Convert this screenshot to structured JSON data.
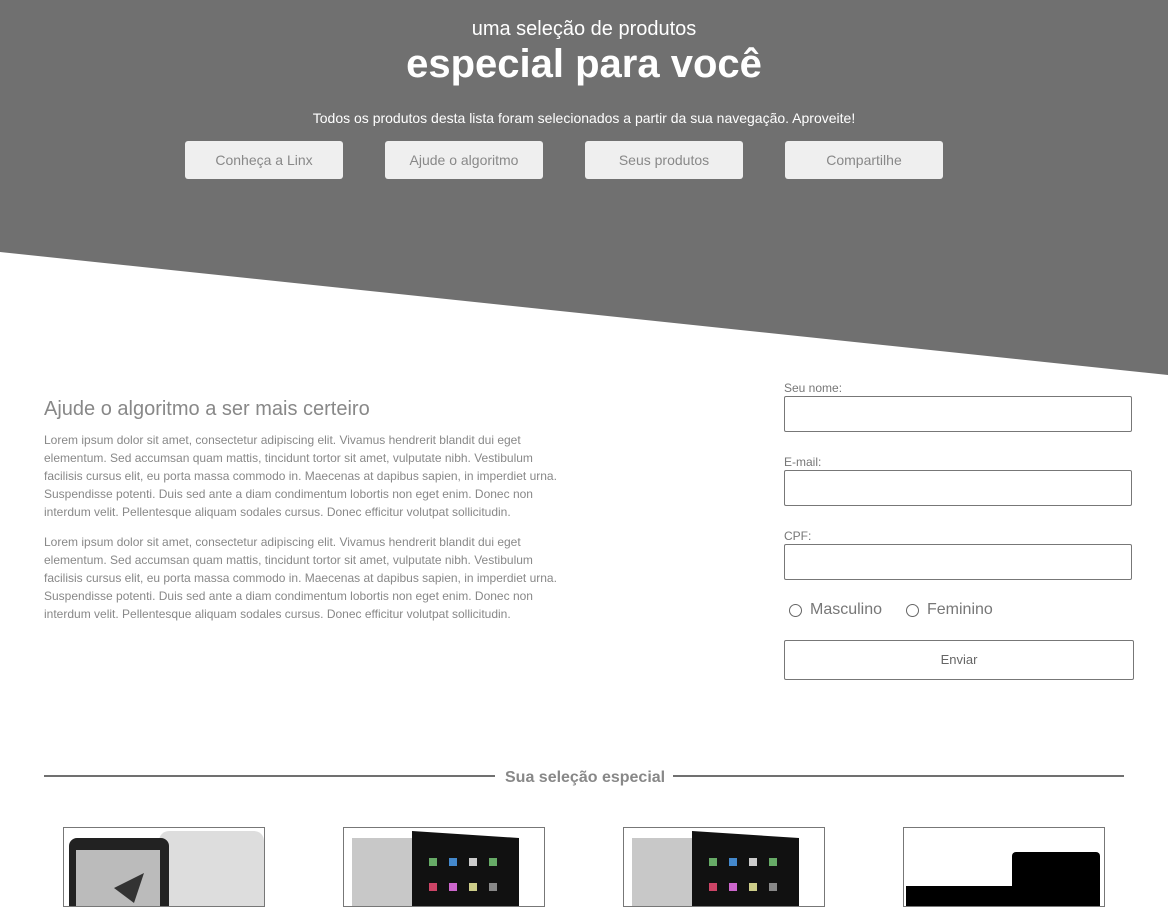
{
  "hero": {
    "subtitle": "uma seleção de produtos",
    "title": "especial para você",
    "description": "Todos os produtos desta lista foram selecionados a partir da sua navegação. Aproveite!",
    "buttons": [
      "Conheça a Linx",
      "Ajude o algoritmo",
      "Seus produtos",
      "Compartilhe"
    ],
    "bg_color": "#707070"
  },
  "info": {
    "heading": "Ajude o algoritmo a ser mais certeiro",
    "paragraphs": [
      "Lorem ipsum dolor sit amet, consectetur adipiscing elit. Vivamus hendrerit blandit dui eget elementum. Sed accumsan quam mattis, tincidunt tortor sit amet, vulputate nibh. Vestibulum facilisis cursus elit, eu porta massa commodo in. Maecenas at dapibus sapien, in imperdiet urna. Suspendisse potenti. Duis sed ante a diam condimentum lobortis non eget enim. Donec non interdum velit. Pellentesque aliquam sodales cursus. Donec efficitur volutpat sollicitudin.",
      "Lorem ipsum dolor sit amet, consectetur adipiscing elit. Vivamus hendrerit blandit dui eget elementum. Sed accumsan quam mattis, tincidunt tortor sit amet, vulputate nibh. Vestibulum facilisis cursus elit, eu porta massa commodo in. Maecenas at dapibus sapien, in imperdiet urna. Suspendisse potenti. Duis sed ante a diam condimentum lobortis non eget enim. Donec non interdum velit. Pellentesque aliquam sodales cursus. Donec efficitur volutpat sollicitudin."
    ]
  },
  "form": {
    "name_label": "Seu nome:",
    "email_label": "E-mail:",
    "cpf_label": "CPF:",
    "name_value": "",
    "email_value": "",
    "cpf_value": "",
    "gender_options": [
      "Masculino",
      "Feminino"
    ],
    "submit_label": "Enviar"
  },
  "selection": {
    "title": "Sua seleção especial"
  }
}
